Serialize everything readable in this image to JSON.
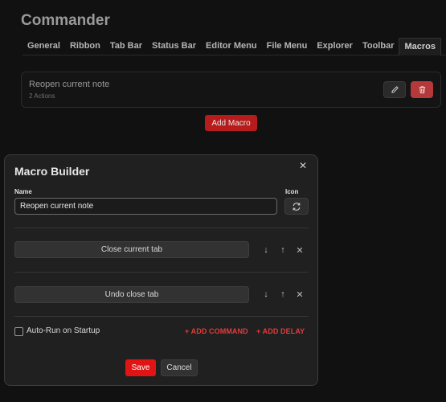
{
  "settings": {
    "title": "Commander",
    "tabs": [
      {
        "label": "General",
        "active": false
      },
      {
        "label": "Ribbon",
        "active": false
      },
      {
        "label": "Tab Bar",
        "active": false
      },
      {
        "label": "Status Bar",
        "active": false
      },
      {
        "label": "Editor Menu",
        "active": false
      },
      {
        "label": "File Menu",
        "active": false
      },
      {
        "label": "Explorer",
        "active": false
      },
      {
        "label": "Toolbar",
        "active": false
      },
      {
        "label": "Macros",
        "active": true
      }
    ],
    "macro": {
      "name": "Reopen current note",
      "actions_count": "2 Actions",
      "edit_icon": "pencil-icon",
      "delete_icon": "trash-icon"
    },
    "add_macro_label": "Add Macro"
  },
  "modal": {
    "title": "Macro Builder",
    "close_glyph": "✕",
    "name_label": "Name",
    "name_value": "Reopen current note",
    "icon_label": "Icon",
    "icon_name": "refresh-icon",
    "commands": [
      {
        "label": "Close current tab"
      },
      {
        "label": "Undo close tab"
      }
    ],
    "row_controls": {
      "down": "↓",
      "up": "↑",
      "remove": "✕"
    },
    "autorun_label": "Auto-Run on Startup",
    "autorun_checked": false,
    "add_command_label": "+ ADD COMMAND",
    "add_delay_label": "+ ADD DELAY",
    "save_label": "Save",
    "cancel_label": "Cancel"
  },
  "colors": {
    "accent": "#e01414",
    "link": "#e33b3b",
    "delete": "#b5393a"
  }
}
